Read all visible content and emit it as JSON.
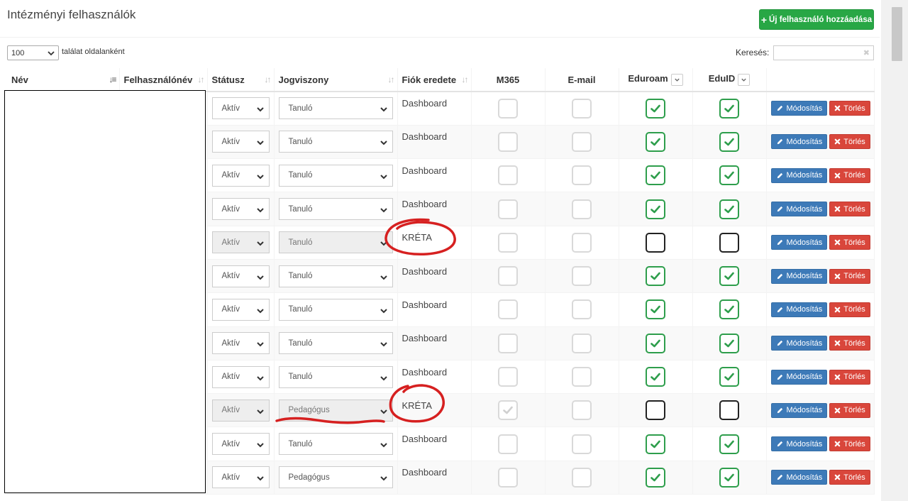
{
  "page": {
    "title": "Intézményi felhasználók"
  },
  "toolbar": {
    "add_user_label": "Új felhasználó hozzáadása"
  },
  "pagination": {
    "page_size": "100",
    "page_size_label": "találat oldalanként"
  },
  "search": {
    "label": "Keresés:",
    "value": ""
  },
  "table": {
    "headers": {
      "name": "Név",
      "username": "Felhasználónév",
      "status": "Státusz",
      "relation": "Jogviszony",
      "origin": "Fiók eredete",
      "m365": "M365",
      "email": "E-mail",
      "eduroam": "Eduroam",
      "eduid": "EduID"
    },
    "edit_label": "Módosítás",
    "delete_label": "Törlés",
    "rows": [
      {
        "status": "Aktív",
        "relation": "Tanuló",
        "origin": "Dashboard",
        "m365": false,
        "email": false,
        "eduroam": true,
        "eduid": true,
        "locked": false
      },
      {
        "status": "Aktív",
        "relation": "Tanuló",
        "origin": "Dashboard",
        "m365": false,
        "email": false,
        "eduroam": true,
        "eduid": true,
        "locked": false
      },
      {
        "status": "Aktív",
        "relation": "Tanuló",
        "origin": "Dashboard",
        "m365": false,
        "email": false,
        "eduroam": true,
        "eduid": true,
        "locked": false
      },
      {
        "status": "Aktív",
        "relation": "Tanuló",
        "origin": "Dashboard",
        "m365": false,
        "email": false,
        "eduroam": true,
        "eduid": true,
        "locked": false
      },
      {
        "status": "Aktív",
        "relation": "Tanuló",
        "origin": "KRÉTA",
        "m365": false,
        "email": false,
        "eduroam": false,
        "eduid": false,
        "locked": true
      },
      {
        "status": "Aktív",
        "relation": "Tanuló",
        "origin": "Dashboard",
        "m365": false,
        "email": false,
        "eduroam": true,
        "eduid": true,
        "locked": false
      },
      {
        "status": "Aktív",
        "relation": "Tanuló",
        "origin": "Dashboard",
        "m365": false,
        "email": false,
        "eduroam": true,
        "eduid": true,
        "locked": false
      },
      {
        "status": "Aktív",
        "relation": "Tanuló",
        "origin": "Dashboard",
        "m365": false,
        "email": false,
        "eduroam": true,
        "eduid": true,
        "locked": false
      },
      {
        "status": "Aktív",
        "relation": "Tanuló",
        "origin": "Dashboard",
        "m365": false,
        "email": false,
        "eduroam": true,
        "eduid": true,
        "locked": false
      },
      {
        "status": "Aktív",
        "relation": "Pedagógus",
        "origin": "KRÉTA",
        "m365": true,
        "email": false,
        "eduroam": false,
        "eduid": false,
        "locked": true
      },
      {
        "status": "Aktív",
        "relation": "Tanuló",
        "origin": "Dashboard",
        "m365": false,
        "email": false,
        "eduroam": true,
        "eduid": true,
        "locked": false
      },
      {
        "status": "Aktív",
        "relation": "Pedagógus",
        "origin": "Dashboard",
        "m365": false,
        "email": false,
        "eduroam": true,
        "eduid": true,
        "locked": false
      }
    ]
  },
  "colors": {
    "add_button": "#28a745",
    "edit_button": "#3d7ab8",
    "delete_button": "#d9463b",
    "checkbox_checked": "#2e9e4c",
    "annotation": "#d62020"
  }
}
